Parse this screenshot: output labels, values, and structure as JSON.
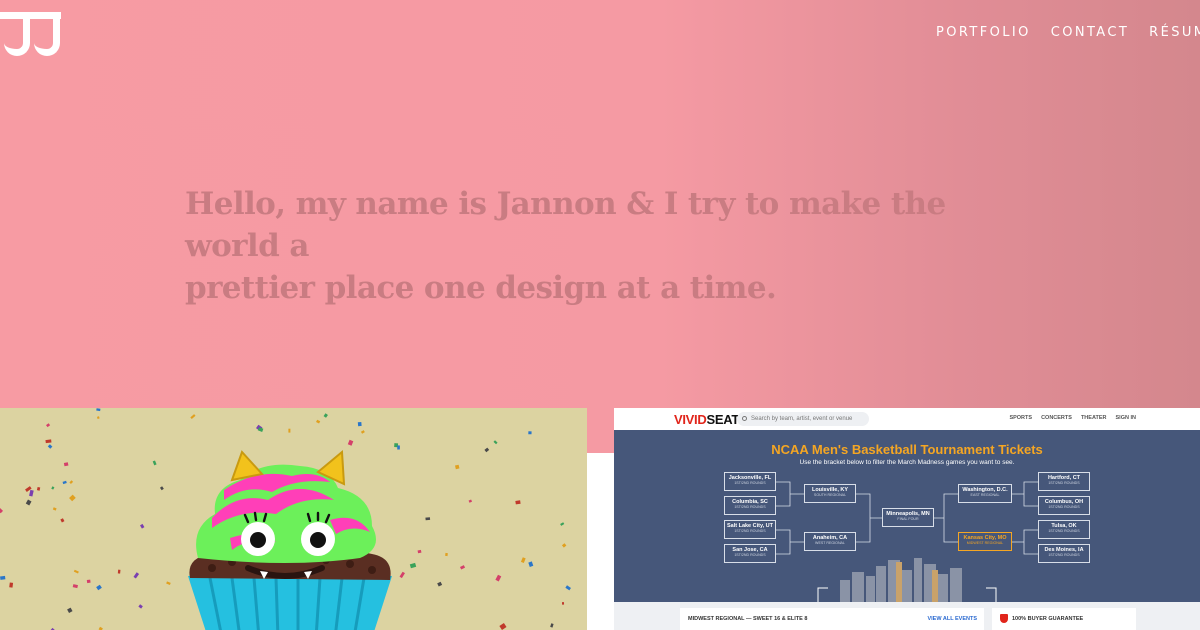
{
  "header": {
    "logo_text": "JJ",
    "nav": [
      "PORTFOLIO",
      "CONTACT",
      "RÉSUMÉ"
    ]
  },
  "hero": {
    "line1": "Hello, my name is Jannon & I try to make the world a",
    "line2": "prettier place one design at a time."
  },
  "vivid": {
    "logo_a": "VIVID",
    "logo_b": "SEATS",
    "search_placeholder": "Search by team, artist, event or venue",
    "menu": [
      "SPORTS",
      "CONCERTS",
      "THEATER",
      "SIGN IN"
    ],
    "title": "NCAA Men's Basketball Tournament Tickets",
    "subtitle": "Use the bracket below to filter the March Madness games you want to see.",
    "bracket_left": [
      {
        "name": "Jacksonville, FL",
        "sub": "1ST/2ND ROUNDS"
      },
      {
        "name": "Columbia, SC",
        "sub": "1ST/2ND ROUNDS"
      },
      {
        "name": "Salt Lake City, UT",
        "sub": "1ST/2ND ROUNDS"
      },
      {
        "name": "San Jose, CA",
        "sub": "1ST/2ND ROUNDS"
      }
    ],
    "bracket_left_mid": [
      {
        "name": "Louisville, KY",
        "sub": "SOUTH REGIONAL"
      },
      {
        "name": "Anaheim, CA",
        "sub": "WEST REGIONAL"
      }
    ],
    "final_four": {
      "name": "Minneapolis, MN",
      "sub": "FINAL FOUR"
    },
    "bracket_right_mid": [
      {
        "name": "Washington, D.C.",
        "sub": "EAST REGIONAL"
      },
      {
        "name": "Kansas City, MO",
        "sub": "MIDWEST REGIONAL"
      }
    ],
    "bracket_right": [
      {
        "name": "Hartford, CT",
        "sub": "1ST/2ND ROUNDS"
      },
      {
        "name": "Columbus, OH",
        "sub": "1ST/2ND ROUNDS"
      },
      {
        "name": "Tulsa, OK",
        "sub": "1ST/2ND ROUNDS"
      },
      {
        "name": "Des Moines, IA",
        "sub": "1ST/2ND ROUNDS"
      }
    ],
    "footer_left": "MIDWEST REGIONAL — SWEET 16 & ELITE 8",
    "footer_link": "VIEW ALL EVENTS",
    "footer_right": "100% BUYER GUARANTEE"
  },
  "colors": {
    "hero_pink": "#f59aa3",
    "headline": "#c97c82",
    "vivid_red": "#e1251b",
    "bracket_bg": "#46577a",
    "accent_orange": "#f5a623"
  }
}
